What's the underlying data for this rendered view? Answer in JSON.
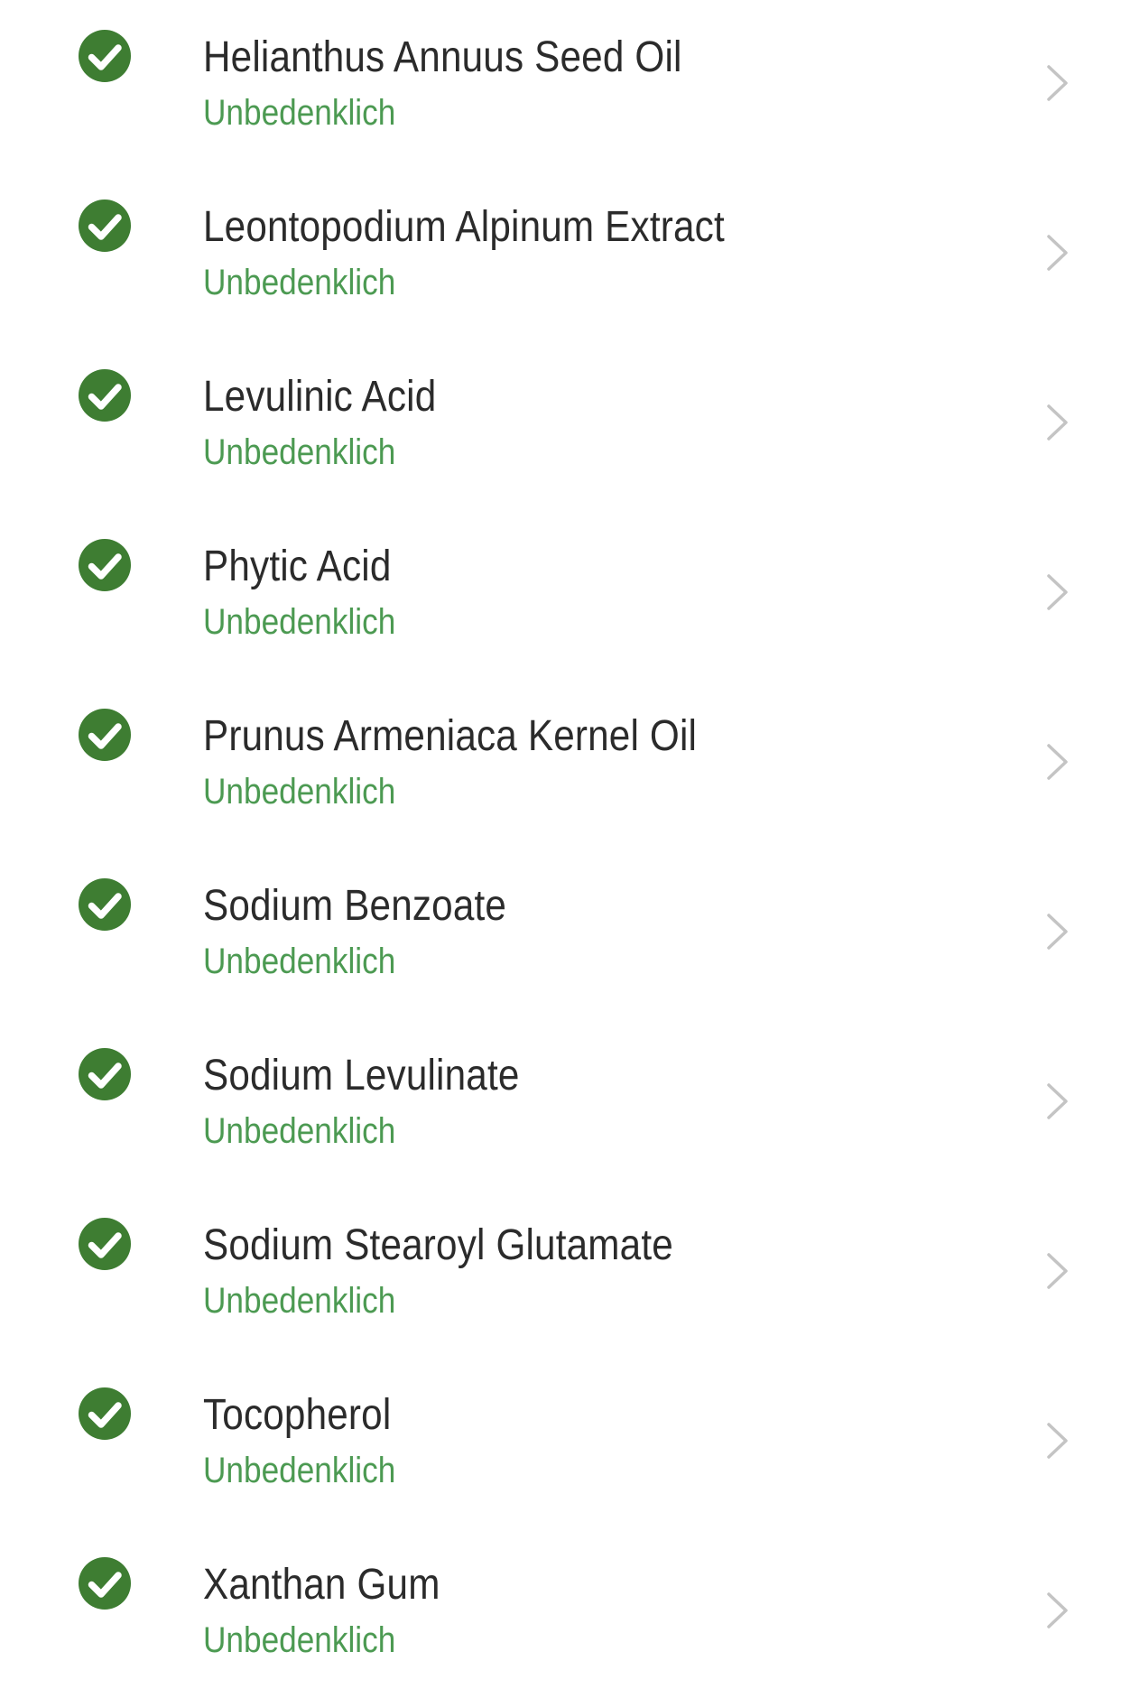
{
  "colors": {
    "safe_green": "#3e7d32",
    "status_green": "#4c9a52",
    "name_text": "#2b2b2b",
    "chevron": "#c4c4c4"
  },
  "icons": {
    "status_icon": "check-circle-icon",
    "row_arrow": "chevron-right-icon"
  },
  "ingredients": [
    {
      "name": "Helianthus Annuus Seed Oil",
      "status": "Unbedenklich"
    },
    {
      "name": "Leontopodium Alpinum Extract",
      "status": "Unbedenklich"
    },
    {
      "name": "Levulinic Acid",
      "status": "Unbedenklich"
    },
    {
      "name": "Phytic Acid",
      "status": "Unbedenklich"
    },
    {
      "name": "Prunus Armeniaca Kernel Oil",
      "status": "Unbedenklich"
    },
    {
      "name": "Sodium Benzoate",
      "status": "Unbedenklich"
    },
    {
      "name": "Sodium Levulinate",
      "status": "Unbedenklich"
    },
    {
      "name": "Sodium Stearoyl Glutamate",
      "status": "Unbedenklich"
    },
    {
      "name": "Tocopherol",
      "status": "Unbedenklich"
    },
    {
      "name": "Xanthan Gum",
      "status": "Unbedenklich"
    }
  ]
}
